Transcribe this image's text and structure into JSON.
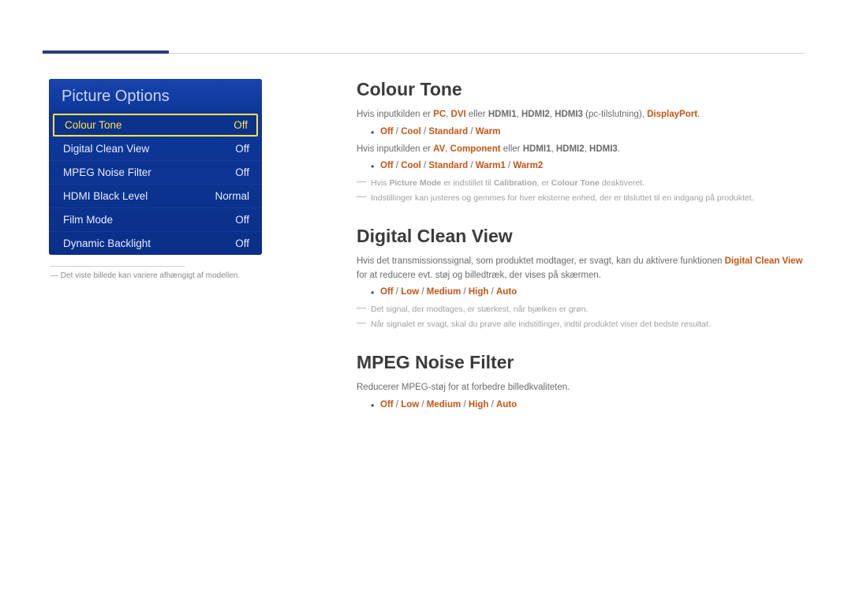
{
  "menu": {
    "title": "Picture Options",
    "items": [
      {
        "label": "Colour Tone",
        "value": "Off",
        "selected": true
      },
      {
        "label": "Digital Clean View",
        "value": "Off"
      },
      {
        "label": "MPEG Noise Filter",
        "value": "Off"
      },
      {
        "label": "HDMI Black Level",
        "value": "Normal"
      },
      {
        "label": "Film Mode",
        "value": "Off"
      },
      {
        "label": "Dynamic Backlight",
        "value": "Off"
      }
    ],
    "footnote_dash": "―",
    "footnote": "Det viste billede kan variere afhængigt af modellen."
  },
  "colour_tone": {
    "heading": "Colour Tone",
    "line1_pre": "Hvis inputkilden er ",
    "line1_pc": "PC",
    "line1_sep1": ", ",
    "line1_dvi": "DVI",
    "line1_mid": " eller ",
    "line1_h1": "HDMI1",
    "line1_sep2": ", ",
    "line1_h2": "HDMI2",
    "line1_sep3": ", ",
    "line1_h3": "HDMI3",
    "line1_paren": " (pc-tilslutning), ",
    "line1_dp": "DisplayPort",
    "line1_end": ".",
    "bullet1_off": "Off",
    "bullet1_s1": " / ",
    "bullet1_cool": "Cool",
    "bullet1_s2": " / ",
    "bullet1_std": "Standard",
    "bullet1_s3": " / ",
    "bullet1_warm": "Warm",
    "line2_pre": "Hvis inputkilden er ",
    "line2_av": "AV",
    "line2_sep1": ", ",
    "line2_comp": "Component",
    "line2_mid": " eller ",
    "line2_h1": "HDMI1",
    "line2_sep2": ", ",
    "line2_h2": "HDMI2",
    "line2_sep3": ", ",
    "line2_h3": "HDMI3",
    "line2_end": ".",
    "bullet2_off": "Off",
    "bullet2_s1": " / ",
    "bullet2_cool": "Cool",
    "bullet2_s2": " / ",
    "bullet2_std": "Standard",
    "bullet2_s3": " / ",
    "bullet2_w1": "Warm1",
    "bullet2_s4": " / ",
    "bullet2_w2": "Warm2",
    "note1_pre": "Hvis ",
    "note1_pm": "Picture Mode",
    "note1_mid": " er indstillet til ",
    "note1_cal": "Calibration",
    "note1_mid2": ", er ",
    "note1_ct": "Colour Tone",
    "note1_end": " deaktiveret.",
    "note2": "Indstillinger kan justeres og gemmes for hver eksterne enhed, der er tilsluttet til en indgang på produktet."
  },
  "dcv": {
    "heading": "Digital Clean View",
    "para_pre": "Hvis det transmissionssignal, som produktet modtager, er svagt, kan du aktivere funktionen ",
    "para_dcv": "Digital Clean View",
    "para_post": " for at reducere evt. støj og billedtræk, der vises på skærmen.",
    "b_off": "Off",
    "b_s1": " / ",
    "b_low": "Low",
    "b_s2": " / ",
    "b_med": "Medium",
    "b_s3": " / ",
    "b_high": "High",
    "b_s4": " / ",
    "b_auto": "Auto",
    "note1": "Det signal, der modtages, er stærkest, når bjælken er grøn.",
    "note2": "Når signalet er svagt, skal du prøve alle indstillinger, indtil produktet viser det bedste resultat."
  },
  "mpeg": {
    "heading": "MPEG Noise Filter",
    "para": "Reducerer MPEG-støj for at forbedre billedkvaliteten.",
    "b_off": "Off",
    "b_s1": " / ",
    "b_low": "Low",
    "b_s2": " / ",
    "b_med": "Medium",
    "b_s3": " / ",
    "b_high": "High",
    "b_s4": " / ",
    "b_auto": "Auto"
  }
}
